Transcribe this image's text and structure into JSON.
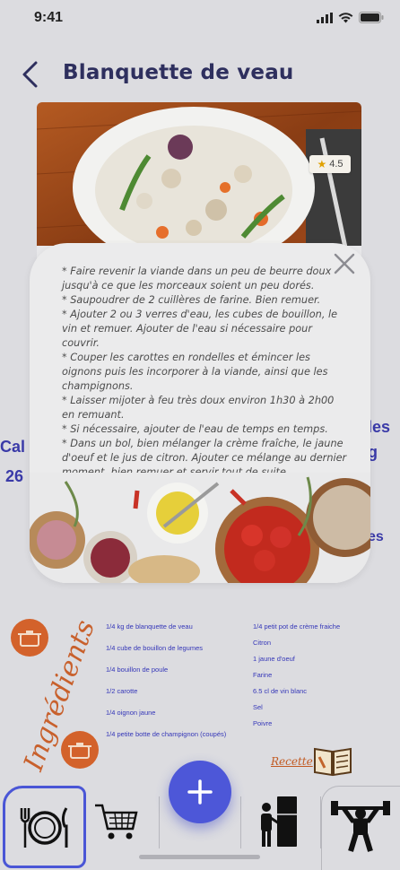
{
  "status": {
    "time": "9:41"
  },
  "header": {
    "title": "Blanquette de veau"
  },
  "rating": {
    "value": "4.5"
  },
  "background_peeks": [
    "Cal",
    "26",
    "les",
    "g",
    "es"
  ],
  "steps": [
    "* Faire revenir la viande dans un peu de beurre doux jusqu'à ce que les morceaux soient un peu dorés.",
    "* Saupoudrer de 2 cuillères de farine. Bien remuer.",
    "* Ajouter 2 ou 3 verres d'eau, les cubes de bouillon, le vin et remuer. Ajouter de l'eau si nécessaire pour couvrir.",
    "* Couper les carottes en rondelles et émincer les oignons puis les incorporer à la viande, ainsi que les champignons.",
    "* Laisser mijoter à feu très doux environ 1h30 à 2h00 en remuant.",
    "* Si nécessaire, ajouter de l'eau de temps en temps.",
    "* Dans un bol, bien mélanger la crème fraîche, le jaune d'oeuf et le jus de citron. Ajouter ce mélange au dernier moment, bien remuer et servir tout de suite."
  ],
  "ingredients": {
    "title": "Ingrédients",
    "left": [
      "1/4 kg de blanquette de veau",
      "1/4 cube de bouillon de legumes",
      "1/4 bouillon de poule",
      "1/2 carotte",
      "1/4 oignon jaune",
      "1/4 petite botte de champignon (coupés)"
    ],
    "right": [
      "1/4 petit pot de crème fraiche",
      "Citron",
      "1 jaune d'oeuf",
      "Farine",
      "6.5 cl de vin blanc",
      "Sel",
      "Poivre"
    ]
  },
  "recette_label": "Recette",
  "tabs": [
    {
      "icon": "plate-cutlery-icon",
      "active": true
    },
    {
      "icon": "shopping-cart-icon",
      "active": false
    },
    {
      "icon": "fridge-person-icon",
      "active": false
    },
    {
      "icon": "weightlifter-icon",
      "active": false
    }
  ],
  "colors": {
    "accent": "#4d57d8",
    "orange": "#d3622b",
    "ingredient_text": "#3537b8",
    "title": "#2e2f5e"
  }
}
